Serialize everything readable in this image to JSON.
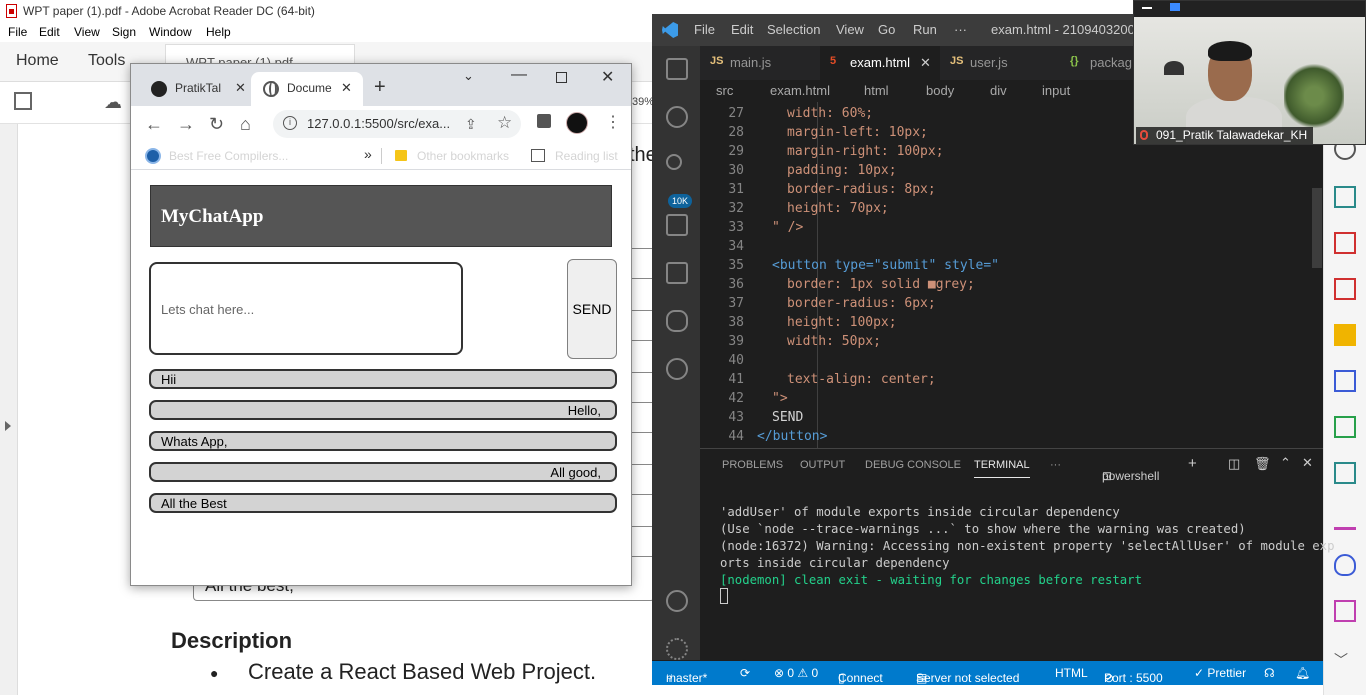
{
  "acrobat": {
    "title": "WPT paper (1).pdf - Adobe Acrobat Reader DC (64-bit)",
    "menu": [
      "File",
      "Edit",
      "View",
      "Sign",
      "Window",
      "Help"
    ],
    "tabs": {
      "home": "Home",
      "tools": "Tools",
      "doc": "WPT paper (1).pdf"
    },
    "zoom": "39%",
    "page": {
      "partial_word": "the",
      "all_best": "All the best,",
      "heading": "Description",
      "bullet": "●",
      "bullet_text": "Create a React Based Web Project."
    }
  },
  "chrome": {
    "tabs": [
      {
        "label": "PratikTal",
        "close": "✕"
      },
      {
        "label": "Docume",
        "close": "✕"
      }
    ],
    "new_tab": "+",
    "url": "127.0.0.1:5500/src/exa...",
    "bookmarks": {
      "item1": "Best Free Compilers...",
      "chevron": "»",
      "other": "Other bookmarks",
      "reading": "Reading list"
    }
  },
  "app": {
    "title": "MyChatApp",
    "input_placeholder": "Lets chat here...",
    "send_label": "SEND",
    "messages": [
      {
        "text": "Hii",
        "align": "left"
      },
      {
        "text": "Hello,",
        "align": "right"
      },
      {
        "text": "Whats App,",
        "align": "left"
      },
      {
        "text": "All good,",
        "align": "right"
      },
      {
        "text": "All the Best",
        "align": "left"
      }
    ]
  },
  "vscode": {
    "menu": [
      "File",
      "Edit",
      "Selection",
      "View",
      "Go",
      "Run",
      "···"
    ],
    "window_title": "exam.html - 2109403200",
    "activity_badge": "10K",
    "tabs": [
      {
        "icon": "JS",
        "label": "main.js"
      },
      {
        "icon": "5",
        "label": "exam.html",
        "close": "✕"
      },
      {
        "icon": "JS",
        "label": "user.js"
      },
      {
        "icon": "{}",
        "label": "packag"
      }
    ],
    "breadcrumb": [
      "src",
      "exam.html",
      "html",
      "body",
      "div",
      "input"
    ],
    "lines": [
      {
        "n": "27",
        "code": "width: 60%;"
      },
      {
        "n": "28",
        "code": "margin-left: 10px;"
      },
      {
        "n": "29",
        "code": "margin-right: 100px;"
      },
      {
        "n": "30",
        "code": "padding: 10px;"
      },
      {
        "n": "31",
        "code": "border-radius: 8px;"
      },
      {
        "n": "32",
        "code": "height: 70px;"
      },
      {
        "n": "33",
        "code": "\" />"
      },
      {
        "n": "34",
        "code": ""
      },
      {
        "n": "35",
        "code": "<button type=\"submit\" style=\""
      },
      {
        "n": "36",
        "code": "border: 1px solid ■grey;"
      },
      {
        "n": "37",
        "code": "border-radius: 6px;"
      },
      {
        "n": "38",
        "code": "height: 100px;"
      },
      {
        "n": "39",
        "code": "width: 50px;"
      },
      {
        "n": "40",
        "code": ""
      },
      {
        "n": "41",
        "code": "text-align: center;"
      },
      {
        "n": "42",
        "code": "\">"
      },
      {
        "n": "43",
        "code": "SEND"
      },
      {
        "n": "44",
        "code": "</button>"
      }
    ],
    "panel_tabs": [
      "PROBLEMS",
      "OUTPUT",
      "DEBUG CONSOLE",
      "TERMINAL",
      "···"
    ],
    "shell": "powershell",
    "terminal": [
      "'addUser' of module exports inside circular dependency",
      "(Use `node --trace-warnings ...` to show where the warning was created)",
      "(node:16372) Warning: Accessing non-existent property 'selectAllUser' of module exp",
      "orts inside circular dependency",
      "[nodemon] clean exit - waiting for changes before restart"
    ],
    "status": {
      "branch": "master*",
      "errors": "⊗ 0 ⚠ 0",
      "connect": "Connect",
      "server": "Server not selected",
      "lang": "HTML",
      "port": "Port : 5500",
      "prettier": "✓ Prettier"
    }
  },
  "webcam": {
    "name": "091_Pratik Talawadekar_KH"
  }
}
